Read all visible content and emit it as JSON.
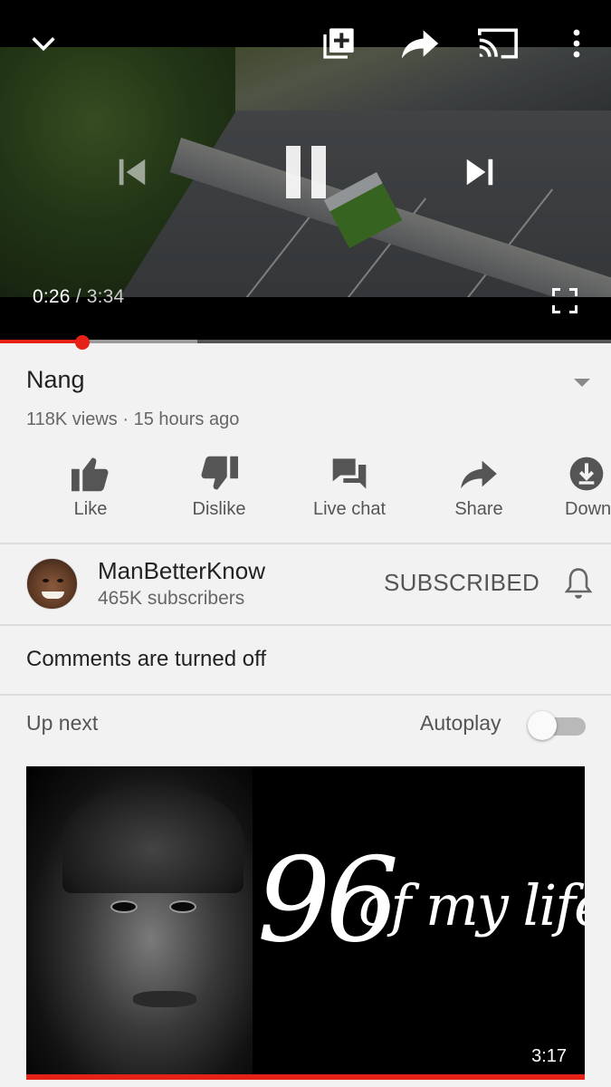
{
  "player": {
    "current_time": "0:26",
    "separator": "/",
    "total_time": "3:34",
    "played_fraction": 0.135,
    "buffered_fraction": 0.323,
    "colors": {
      "progress": "#e62117",
      "buffer": "#9b9b9b",
      "track": "#555555"
    },
    "icons": {
      "minimize": "chevron-down-icon",
      "add_to_playlist": "add-to-playlist-icon",
      "share": "share-icon",
      "cast": "cast-icon",
      "more": "more-vert-icon",
      "previous": "skip-previous-icon",
      "pause": "pause-icon",
      "next": "skip-next-icon",
      "fullscreen": "fullscreen-icon"
    }
  },
  "video": {
    "title": "Nang",
    "meta": "118K views · 15 hours ago"
  },
  "actions": [
    {
      "label": "Like",
      "icon": "thumb-up-icon"
    },
    {
      "label": "Dislike",
      "icon": "thumb-down-icon"
    },
    {
      "label": "Live chat",
      "icon": "chat-icon"
    },
    {
      "label": "Share",
      "icon": "share-icon"
    },
    {
      "label": "Download",
      "icon": "download-icon"
    }
  ],
  "channel": {
    "name": "ManBetterKnow",
    "subscribers": "465K subscribers",
    "subscribe_state": "SUBSCRIBED",
    "bell_icon": "bell-icon"
  },
  "comments": {
    "status": "Comments are turned off"
  },
  "up_next": {
    "label": "Up next",
    "autoplay_label": "Autoplay",
    "autoplay_on": false,
    "card": {
      "title_big": "96",
      "title_rest": "of my life",
      "duration": "3:17"
    }
  },
  "colors": {
    "accent": "#e62117",
    "background": "#f2f2f2",
    "text_primary": "#222222",
    "text_secondary": "#666666"
  }
}
